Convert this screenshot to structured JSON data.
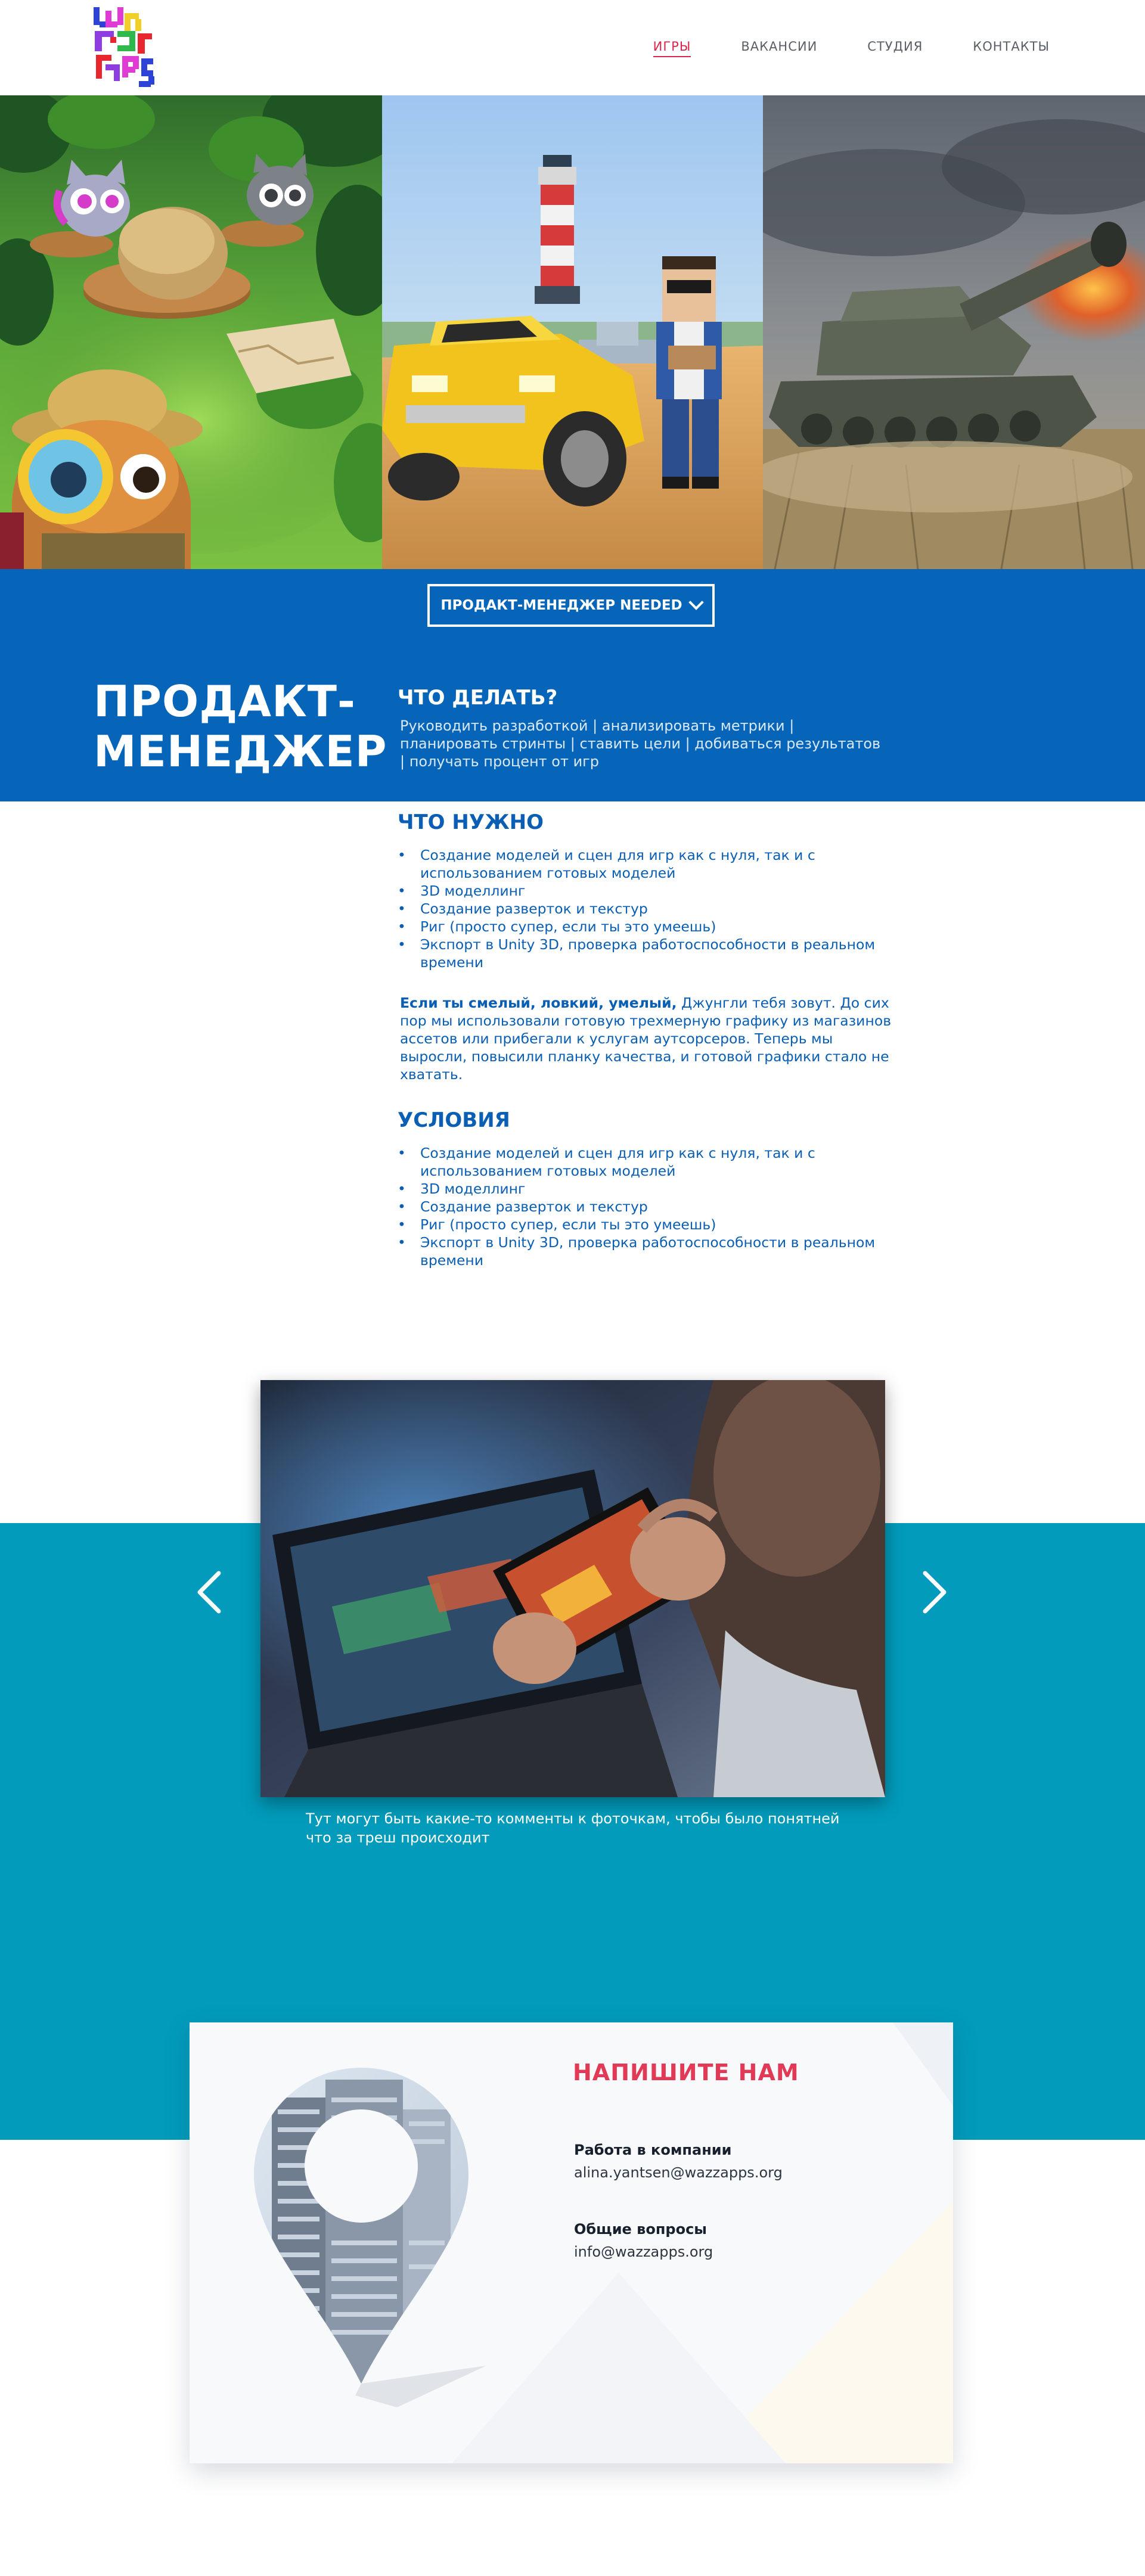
{
  "header": {
    "nav": [
      {
        "label": "ИГРЫ",
        "active": true
      },
      {
        "label": "ВАКАНСИИ",
        "active": false
      },
      {
        "label": "СТУДИЯ",
        "active": false
      },
      {
        "label": "КОНТАКТЫ",
        "active": false
      }
    ]
  },
  "job": {
    "select_label": "ПРОДАКТ-МЕНЕДЖЕР NEEDED",
    "title_line1": "ПРОДАКТ-",
    "title_line2": "МЕНЕДЖЕР",
    "todo_heading": "ЧТО ДЕЛАТЬ?",
    "todo_text": "Руководить разработкой | анализировать метрики | планировать стринты | ставить цели | добиваться результатов | получать процент от игр"
  },
  "requirements": {
    "heading": "ЧТО НУЖНО",
    "items": [
      "Создание моделей и сцен для игр как с нуля, так и с использованием готовых моделей",
      "3D моделлинг",
      "Создание разверток и текстур",
      "Риг (просто супер, если ты это умеешь)",
      "Экспорт в Unity 3D, проверка работоспособности в реальном времени"
    ],
    "para_bold": "Если ты смелый, ловкий, умелый,",
    "para_text": " Джунгли тебя зовут. До сих пор мы использовали готовую трехмерную графику из магазинов ассетов или прибегали к услугам аутсорсеров. Теперь мы выросли, повысили планку качества, и готовой графики стало не хватать."
  },
  "conditions": {
    "heading": "УСЛОВИЯ",
    "items": [
      "Создание моделей и сцен для игр как с нуля, так и с использованием готовых моделей",
      "3D моделлинг",
      "Создание разверток и текстур",
      "Риг (просто супер, если ты это умеешь)",
      "Экспорт в Unity 3D, проверка работоспособности в реальном времени"
    ]
  },
  "carousel": {
    "caption": "Тут могут быть какие-то комменты к фоточкам, чтобы было понятней что за треш происходит"
  },
  "contact": {
    "heading": "НАПИШИТЕ НАМ",
    "work_label": "Работа в компании",
    "work_email": "alina.yantsen@wazzapps.org",
    "general_label": "Общие вопросы",
    "general_email": "info@wazzapps.org"
  },
  "colors": {
    "nav_active": "#d8274e",
    "band_blue": "#0665b8",
    "text_blue": "#0a5fb4",
    "teal": "#029bbb",
    "contact_heading": "#e03a57"
  },
  "icons": {
    "logo": "wazzapps-pixel-logo",
    "select_chevron": "chevron-down-icon",
    "carousel_prev": "chevron-left-icon",
    "carousel_next": "chevron-right-icon",
    "location_pin": "map-pin-icon"
  }
}
